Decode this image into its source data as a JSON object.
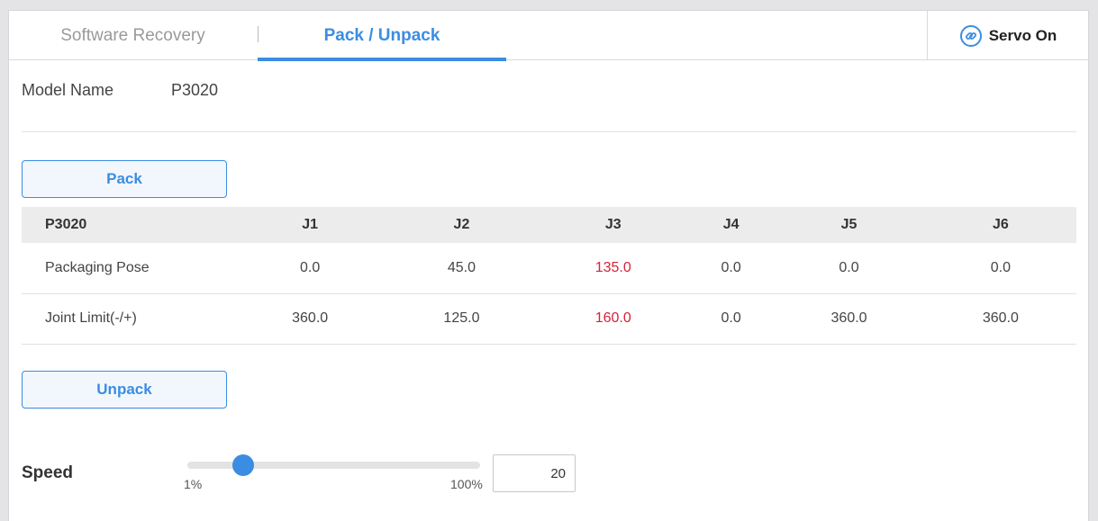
{
  "tabs": [
    {
      "label": "Software Recovery",
      "active": false
    },
    {
      "label": "Pack / Unpack",
      "active": true
    }
  ],
  "servo": {
    "label": "Servo On",
    "icon": "servo-link-icon"
  },
  "model": {
    "label": "Model Name",
    "value": "P3020"
  },
  "buttons": {
    "pack": "Pack",
    "unpack": "Unpack"
  },
  "table": {
    "header": [
      "P3020",
      "J1",
      "J2",
      "J3",
      "J4",
      "J5",
      "J6"
    ],
    "rows": [
      {
        "label": "Packaging Pose",
        "values": [
          "0.0",
          "45.0",
          "135.0",
          "0.0",
          "0.0",
          "0.0"
        ]
      },
      {
        "label": "Joint Limit(-/+)",
        "values": [
          "360.0",
          "125.0",
          "160.0",
          "0.0",
          "360.0",
          "360.0"
        ]
      }
    ],
    "highlight_column": "J3",
    "highlight_color": "#d6223a"
  },
  "speed": {
    "label": "Speed",
    "min_label": "1%",
    "max_label": "100%",
    "value": "20"
  },
  "colors": {
    "accent": "#3b8de2",
    "warning": "#d6223a"
  }
}
